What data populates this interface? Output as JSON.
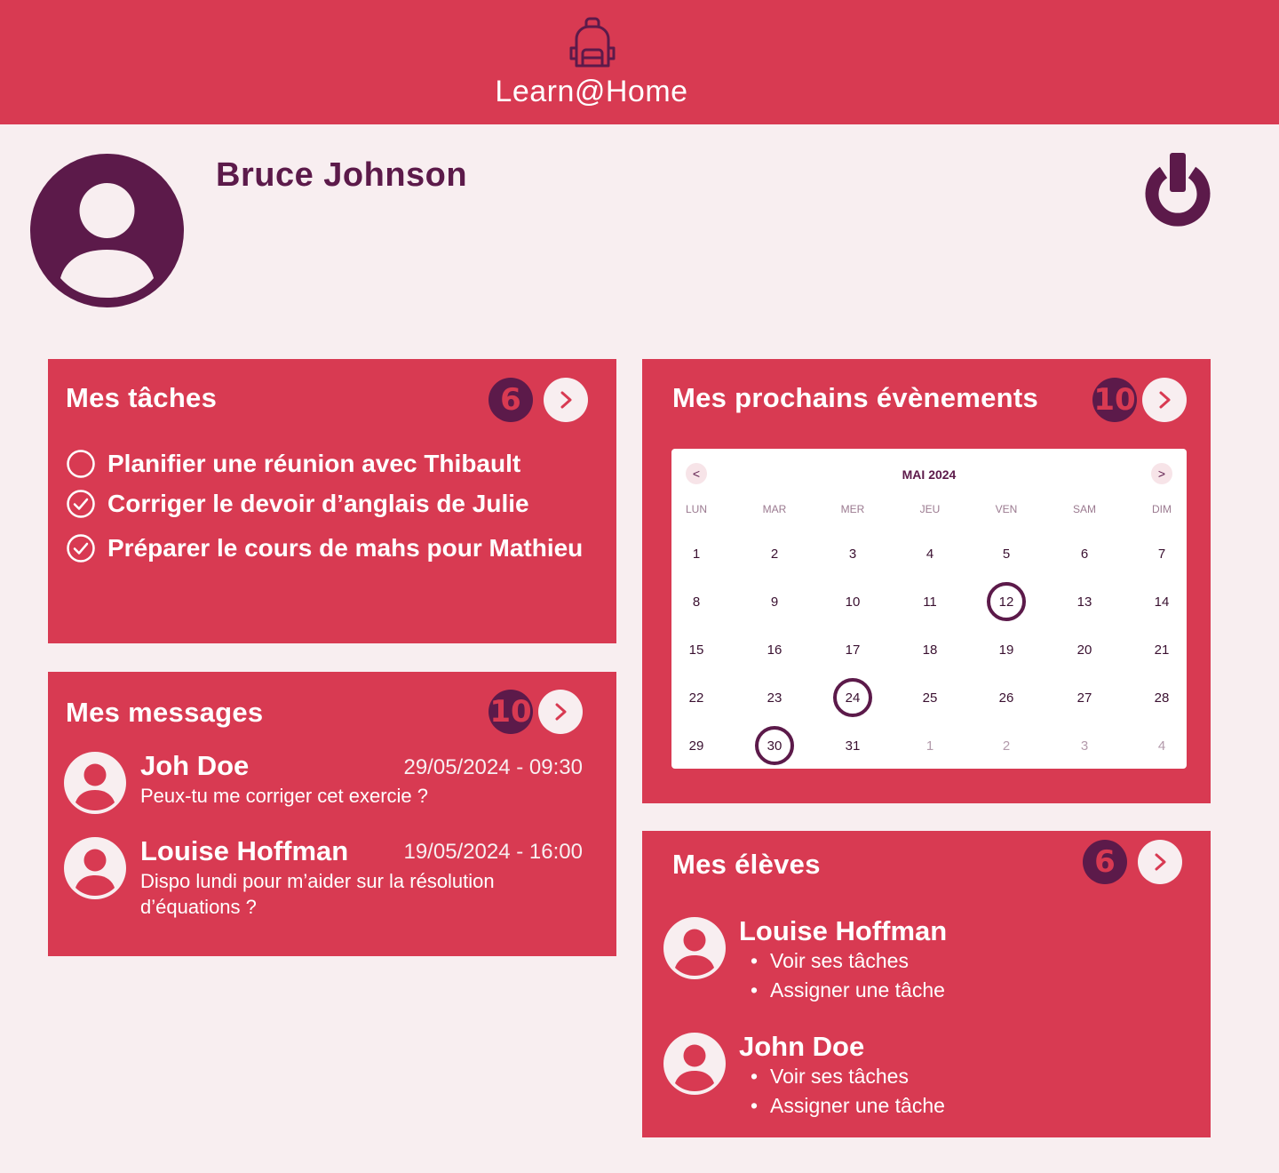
{
  "app": {
    "name": "Learn@Home",
    "logo_icon": "backpack-icon"
  },
  "user": {
    "name": "Bruce Johnson",
    "avatar_icon": "user-avatar-icon",
    "logout_icon": "power-icon"
  },
  "colors": {
    "primary": "#d83a52",
    "dark": "#5c1a4a",
    "background": "#f8eef0"
  },
  "tasks": {
    "title": "Mes tâches",
    "count": "6",
    "items": [
      {
        "label": "Planifier une réunion avec Thibault",
        "done": false
      },
      {
        "label": "Corriger le devoir d’anglais de Julie",
        "done": true
      },
      {
        "label": "Préparer le cours de mahs pour Mathieu",
        "done": true
      }
    ]
  },
  "messages": {
    "title": "Mes messages",
    "count": "10",
    "items": [
      {
        "sender": "Joh Doe",
        "datetime": "29/05/2024 - 09:30",
        "text": "Peux-tu me corriger cet exercie ?"
      },
      {
        "sender": "Louise Hoffman",
        "datetime": "19/05/2024 - 16:00",
        "text": "Dispo lundi pour m’aider sur la résolution d’équations ?"
      }
    ]
  },
  "events": {
    "title": "Mes prochains évènements",
    "count": "10",
    "calendar": {
      "month": "MAI 2024",
      "prev": "<",
      "next": ">",
      "weekdays": [
        "LUN",
        "MAR",
        "MER",
        "JEU",
        "VEN",
        "SAM",
        "DIM"
      ],
      "weeks": [
        [
          "1",
          "2",
          "3",
          "4",
          "5",
          "6",
          "7"
        ],
        [
          "8",
          "9",
          "10",
          "11",
          "12",
          "13",
          "14"
        ],
        [
          "15",
          "16",
          "17",
          "18",
          "19",
          "20",
          "21"
        ],
        [
          "22",
          "23",
          "24",
          "25",
          "26",
          "27",
          "28"
        ],
        [
          "29",
          "30",
          "31",
          "1",
          "2",
          "3",
          "4"
        ]
      ],
      "next_month_days_in_last_week": 4,
      "event_days": [
        "12",
        "24",
        "30"
      ]
    }
  },
  "students": {
    "title": "Mes élèves",
    "count": "6",
    "items": [
      {
        "name": "Louise Hoffman",
        "actions": [
          "Voir ses tâches",
          "Assigner une tâche"
        ]
      },
      {
        "name": "John Doe",
        "actions": [
          "Voir ses tâches",
          "Assigner une tâche"
        ]
      }
    ]
  }
}
